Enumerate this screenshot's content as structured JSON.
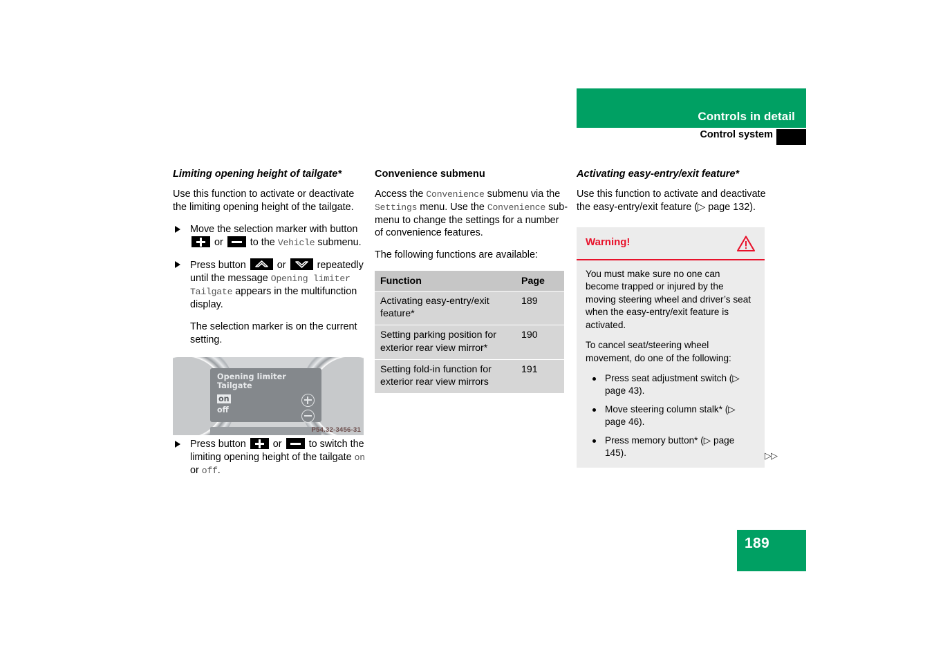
{
  "header": {
    "title": "Controls in detail",
    "subtitle": "Control system",
    "band_color": "#00a063"
  },
  "page_number": "189",
  "left_column": {
    "title": "Limiting opening height of tailgate*",
    "intro": "Use this function to activate or deactivate the limiting opening height of the tailgate.",
    "step1": {
      "pre": "Move the selection marker with button ",
      "mid": " or ",
      "post": " to the ",
      "mono": "Vehicle",
      "tail": " submenu."
    },
    "step2": {
      "pre": "Press button ",
      "mid": " or ",
      "post": " repeatedly until the message ",
      "mono1": "Opening limiter Tailgate",
      "tail": " appears in the multifunction display."
    },
    "note": "The selection marker is on the current setting.",
    "step3": {
      "pre": "Press button ",
      "mid": " or ",
      "post": " to switch the limiting opening height of the tailgate ",
      "mono_on": "on",
      "joiner": " or ",
      "mono_off": "off",
      "tail": "."
    },
    "figure": {
      "display_line1": "Opening limiter",
      "display_line2": "Tailgate",
      "option_on": "on",
      "option_off": "off",
      "caption": "P54.32-3456-31"
    }
  },
  "middle_column": {
    "title": "Convenience submenu",
    "para1_a": "Access the ",
    "para1_mono1": "Convenience",
    "para1_b": " submenu via the ",
    "para1_mono2": "Settings",
    "para1_c": " menu. Use the ",
    "para1_mono3": "Convenience",
    "para1_d": " sub-menu to change the settings for a number of convenience features.",
    "para2": "The following functions are available:",
    "table": {
      "headers": [
        "Function",
        "Page"
      ],
      "rows": [
        {
          "function": "Activating easy-entry/exit feature*",
          "page": "189"
        },
        {
          "function": "Setting parking position for exterior rear view mirror*",
          "page": "190"
        },
        {
          "function": "Setting fold-in function for exterior rear view mirrors",
          "page": "191"
        }
      ]
    }
  },
  "right_column": {
    "title": "Activating easy-entry/exit feature*",
    "intro": "Use this function to activate and deactivate the easy-entry/exit feature (▷ page 132).",
    "warning": {
      "label": "Warning!",
      "accent_color": "#e8122b",
      "para1": "You must make sure no one can become trapped or injured by the moving steering wheel and driver’s seat when the easy-entry/exit feature is activated.",
      "para2": "To cancel seat/steering wheel movement, do one of the following:",
      "bullets": [
        "Press seat adjustment switch (▷ page 43).",
        "Move steering column stalk* (▷ page 46).",
        "Press memory button* (▷ page 145)."
      ],
      "continuation": "▷▷"
    }
  }
}
